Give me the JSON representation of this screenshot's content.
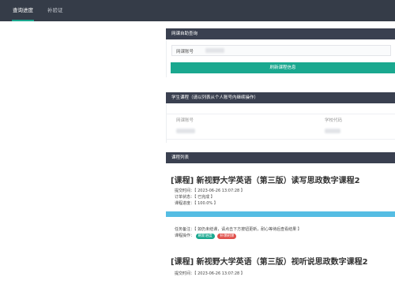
{
  "nav": {
    "tabs": [
      {
        "label": "查询进度"
      },
      {
        "label": "补验证"
      }
    ]
  },
  "query_panel": {
    "header": "网课自助查询",
    "account_label": "网课账号",
    "button_label": "刷新课程信息"
  },
  "student_panel": {
    "header": "学生课程（请以列表从个人账号内继续操作）",
    "col_account": "网课账号",
    "col_school": "学校代码"
  },
  "course_panel": {
    "header": "课程列表"
  },
  "courses": [
    {
      "title": "[课程] 新视野大学英语（第三版）读写思政数字课程2",
      "submit_time": "提交时间：【 2023-06-26 13:07:28 】",
      "status": "订单状态：【 已完成 】",
      "progress_text": "课程进度：【 100.0% 】",
      "progress_value": 1.0,
      "remark": "任务备注：【 如仍未结课，请点击下方按钮更新，耐心等待后查看结果 】",
      "ops_label": "课程操作：",
      "btn_update": "刷新进度",
      "btn_extra": "补课刷课"
    },
    {
      "title": "[课程] 新视野大学英语（第三版）视听说思政数字课程2",
      "submit_time": "提交时间：【 2023-06-26 13:07:28 】"
    }
  ],
  "colors": {
    "nav_bg": "#353c48",
    "header_bg": "#3a4050",
    "accent_green": "#1aa88f",
    "progress_blue": "#55bde3",
    "badge_red": "#e0504b"
  }
}
